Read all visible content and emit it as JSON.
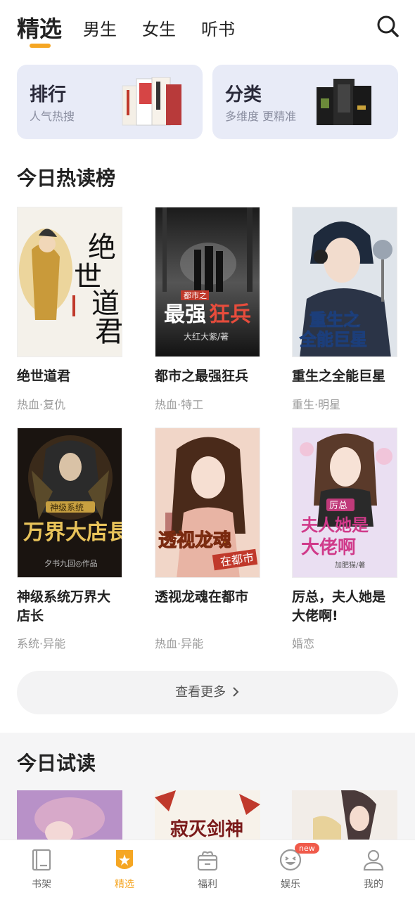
{
  "tabs": [
    {
      "label": "精选",
      "active": true
    },
    {
      "label": "男生"
    },
    {
      "label": "女生"
    },
    {
      "label": "听书"
    }
  ],
  "icons": {
    "search": "search-icon"
  },
  "categories": [
    {
      "title": "排行",
      "subtitle": "人气热搜"
    },
    {
      "title": "分类",
      "subtitle": "多维度 更精准"
    }
  ],
  "hot_section": {
    "title": "今日热读榜"
  },
  "books": [
    {
      "title": "绝世道君",
      "tags": "热血·复仇"
    },
    {
      "title": "都市之最强狂兵",
      "tags": "热血·特工"
    },
    {
      "title": "重生之全能巨星",
      "tags": "重生·明星"
    },
    {
      "title": "神级系统万界大店长",
      "tags": "系统·异能"
    },
    {
      "title": "透视龙魂在都市",
      "tags": "热血·异能"
    },
    {
      "title": "厉总，夫人她是大佬啊!",
      "tags": "婚恋"
    }
  ],
  "more_button": {
    "label": "查看更多"
  },
  "trial_section": {
    "title": "今日试读"
  },
  "bottom_nav": [
    {
      "label": "书架"
    },
    {
      "label": "精选",
      "active": true
    },
    {
      "label": "福利"
    },
    {
      "label": "娱乐",
      "badge": "new"
    },
    {
      "label": "我的"
    }
  ],
  "colors": {
    "accent": "#f5a623",
    "badge": "#f05a4a",
    "card_bg": "#e8ebf7"
  }
}
